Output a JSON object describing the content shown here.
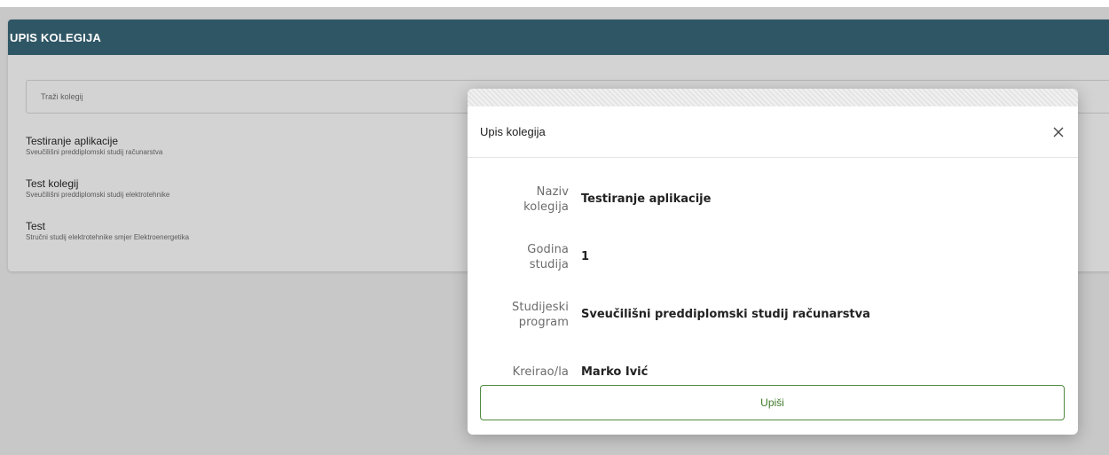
{
  "page": {
    "header_title": "UPIS KOLEGIJA",
    "search_placeholder": "Traži kolegij",
    "courses": [
      {
        "name": "Testiranje aplikacije",
        "program": "Sveučilišni preddiplomski studij računarstva"
      },
      {
        "name": "Test kolegij",
        "program": "Sveučilišni preddiplomski studij elektrotehnike"
      },
      {
        "name": "Test",
        "program": "Stručni studij elektrotehnike smjer Elektroenergetika"
      }
    ]
  },
  "modal": {
    "title": "Upis kolegija",
    "close_icon": "close-icon",
    "fields": [
      {
        "label_line1": "Naziv",
        "label_line2": "kolegija",
        "value": "Testiranje aplikacije"
      },
      {
        "label_line1": "Godina",
        "label_line2": "studija",
        "value": "1"
      },
      {
        "label_line1": "Studijeski",
        "label_line2": "program",
        "value": "Sveučilišni preddiplomski studij računarstva"
      },
      {
        "label_line1": "Kreirao/la",
        "label_line2": "",
        "value": "Marko Ivić"
      }
    ],
    "enroll_label": "Upiši"
  },
  "colors": {
    "header_bg": "#2f5665",
    "button_accent": "#3d7a28"
  }
}
